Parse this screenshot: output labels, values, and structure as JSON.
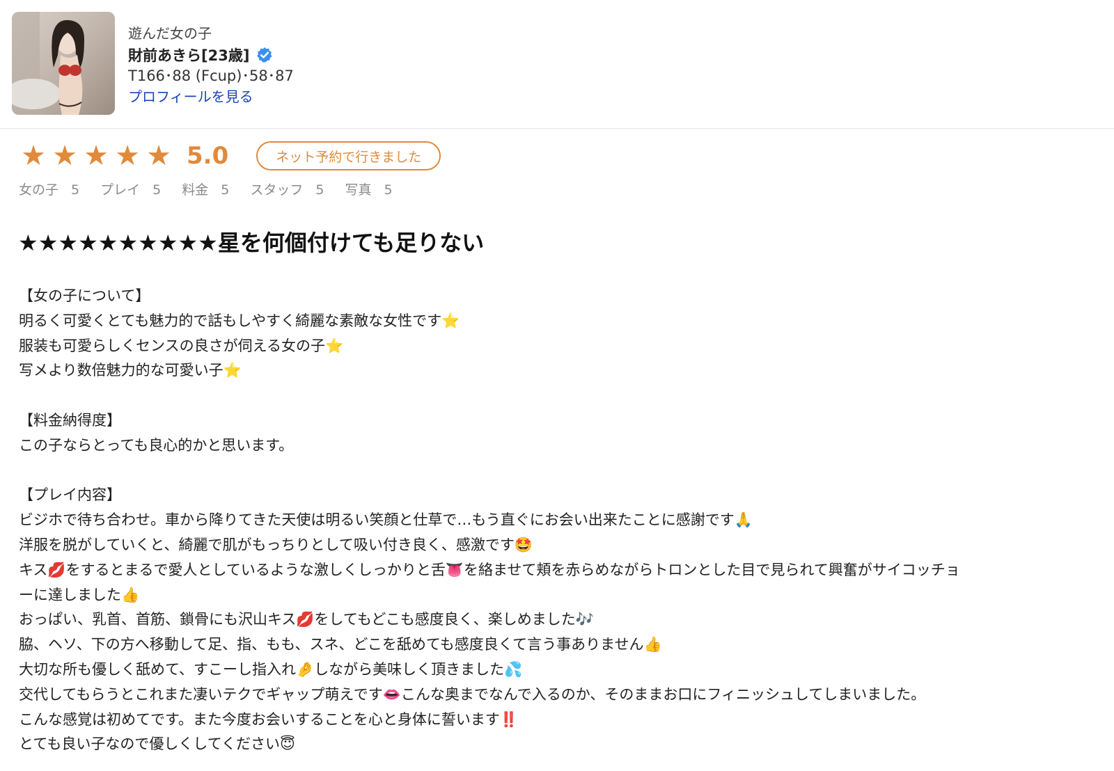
{
  "profile": {
    "label": "遊んだ女の子",
    "name": "財前あきら[23歳]",
    "measurements": "T166･88 (Fcup)･58･87",
    "profile_link": "プロフィールを見る",
    "verified_color": "#3b8ff0"
  },
  "rating": {
    "stars": 5,
    "score": "5.0",
    "badge": "ネット予約で行きました",
    "accent_color": "#e08a3a",
    "sub_ratings": [
      {
        "label": "女の子",
        "value": "5"
      },
      {
        "label": "プレイ",
        "value": "5"
      },
      {
        "label": "料金",
        "value": "5"
      },
      {
        "label": "スタッフ",
        "value": "5"
      },
      {
        "label": "写真",
        "value": "5"
      }
    ]
  },
  "review": {
    "headline": "★★★★★★★★★★星を何個付けても足りない",
    "lines": [
      "【女の子について】",
      "明るく可愛くとても魅力的で話もしやすく綺麗な素敵な女性です⭐",
      "服装も可愛らしくセンスの良さが伺える女の子⭐",
      "写メより数倍魅力的な可愛い子⭐",
      "",
      "【料金納得度】",
      "この子ならとっても良心的かと思います。",
      "",
      "【プレイ内容】",
      "ビジホで待ち合わせ。車から降りてきた天使は明るい笑顔と仕草で…もう直ぐにお会い出来たことに感謝です🙏",
      "洋服を脱がしていくと、綺麗で肌がもっちりとして吸い付き良く、感激です🤩",
      "キス💋をするとまるで愛人としているような激しくしっかりと舌👅を絡ませて頬を赤らめながらトロンとした目で見られて興奮がサイコッチョ",
      "ーに達しました👍",
      "おっぱい、乳首、首筋、鎖骨にも沢山キス💋をしてもどこも感度良く、楽しめました🎶",
      "脇、ヘソ、下の方へ移動して足、指、もも、スネ、どこを舐めても感度良くて言う事ありません👍",
      "大切な所も優しく舐めて、すこーし指入れ🤌しながら美味しく頂きました💦",
      "交代してもらうとこれまた凄いテクでギャップ萌えです👄こんな奥までなんで入るのか、そのままお口にフィニッシュしてしまいました。",
      "こんな感覚は初めてです。また今度お会いすることを心と身体に誓います‼️",
      "とても良い子なので優しくしてください😇"
    ]
  }
}
